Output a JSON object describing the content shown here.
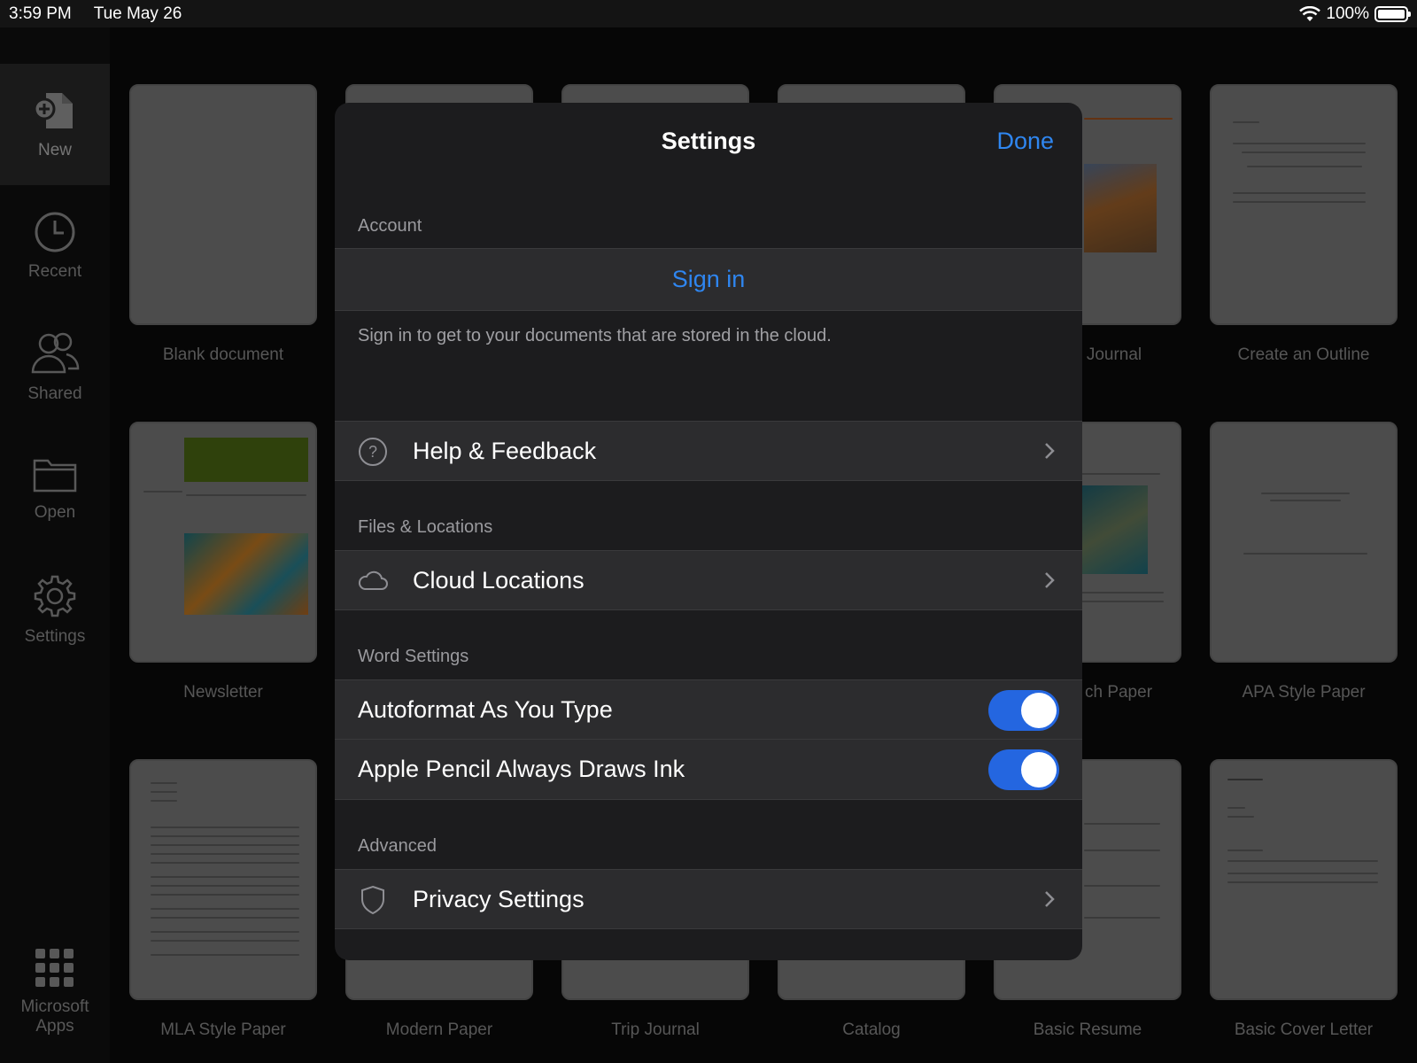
{
  "status_bar": {
    "time": "3:59 PM",
    "date": "Tue May 26",
    "battery": "100%",
    "wifi_icon": "wifi-icon"
  },
  "sidebar": {
    "items": [
      {
        "label": "New",
        "icon": "new-document-icon"
      },
      {
        "label": "Recent",
        "icon": "clock-icon"
      },
      {
        "label": "Shared",
        "icon": "people-icon"
      },
      {
        "label": "Open",
        "icon": "folder-icon"
      },
      {
        "label": "Settings",
        "icon": "gear-icon"
      },
      {
        "label": "Microsoft Apps",
        "icon": "apps-grid-icon"
      }
    ]
  },
  "templates": [
    {
      "label": "Blank document"
    },
    {
      "label": "Journal"
    },
    {
      "label": "Create an Outline"
    },
    {
      "label": "Newsletter"
    },
    {
      "label": "ch Paper"
    },
    {
      "label": "APA Style Paper"
    },
    {
      "label": "MLA Style Paper"
    },
    {
      "label": "Modern Paper"
    },
    {
      "label": "Trip Journal"
    },
    {
      "label": "Catalog"
    },
    {
      "label": "Basic Resume"
    },
    {
      "label": "Basic Cover Letter"
    }
  ],
  "settings": {
    "title": "Settings",
    "done": "Done",
    "account": {
      "header": "Account",
      "sign_in": "Sign in",
      "description": "Sign in to get to your documents that are stored in the cloud."
    },
    "help_feedback": "Help & Feedback",
    "files_locations": {
      "header": "Files & Locations",
      "cloud_locations": "Cloud Locations"
    },
    "word_settings": {
      "header": "Word Settings",
      "autoformat": "Autoformat As You Type",
      "autoformat_on": true,
      "apple_pencil": "Apple Pencil Always Draws Ink",
      "apple_pencil_on": true
    },
    "advanced": {
      "header": "Advanced",
      "privacy": "Privacy Settings"
    }
  },
  "colors": {
    "accent": "#2f86f0",
    "toggle_on": "#2466e0"
  }
}
